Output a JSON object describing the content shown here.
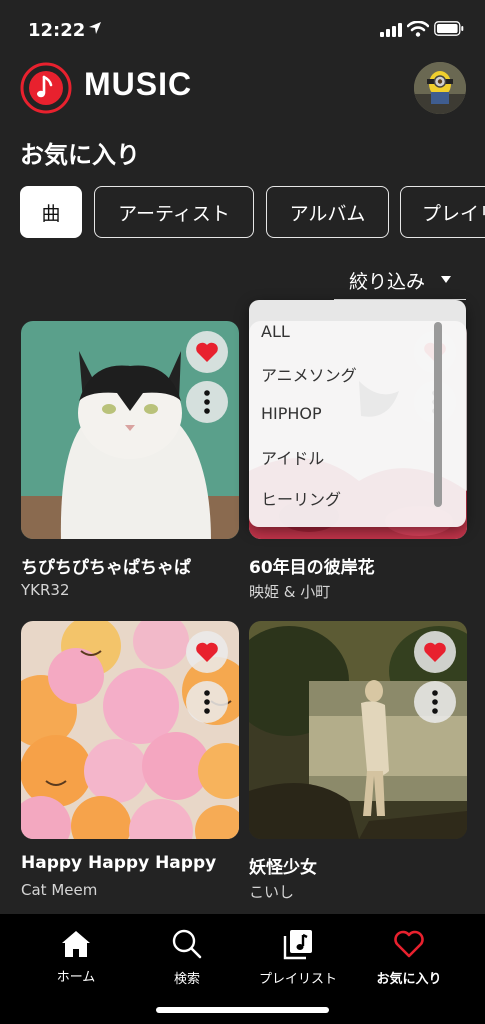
{
  "status_bar": {
    "time": "12:22"
  },
  "header": {
    "brand": "MUSIC"
  },
  "page": {
    "title": "お気に入り"
  },
  "tabs": [
    {
      "label": "曲",
      "active": true
    },
    {
      "label": "アーティスト",
      "active": false
    },
    {
      "label": "アルバム",
      "active": false
    },
    {
      "label": "プレイリスト",
      "active": false
    }
  ],
  "filter": {
    "label": "絞り込み"
  },
  "dropdown": {
    "options": [
      "ALL",
      "アニメソング",
      "HIPHOP",
      "アイドル",
      "ヒーリング"
    ]
  },
  "songs": [
    {
      "title": "ちぴちぴちゃぱちゃぱ",
      "artist": "YKR32",
      "favorite": true
    },
    {
      "title": "60年目の彼岸花",
      "artist": "映姫 & 小町",
      "favorite": true
    },
    {
      "title": "Happy Happy Happy",
      "artist": "Cat Meem",
      "favorite": true
    },
    {
      "title": "妖怪少女",
      "artist": "こいし",
      "favorite": true
    }
  ],
  "bottom_nav": [
    {
      "label": "ホーム",
      "icon": "home-icon",
      "active": false
    },
    {
      "label": "検索",
      "icon": "search-icon",
      "active": false
    },
    {
      "label": "プレイリスト",
      "icon": "playlist-icon",
      "active": false
    },
    {
      "label": "お気に入り",
      "icon": "heart-icon",
      "active": true
    }
  ],
  "colors": {
    "accent": "#e8212e",
    "background": "#232323",
    "nav_background": "#000000"
  }
}
